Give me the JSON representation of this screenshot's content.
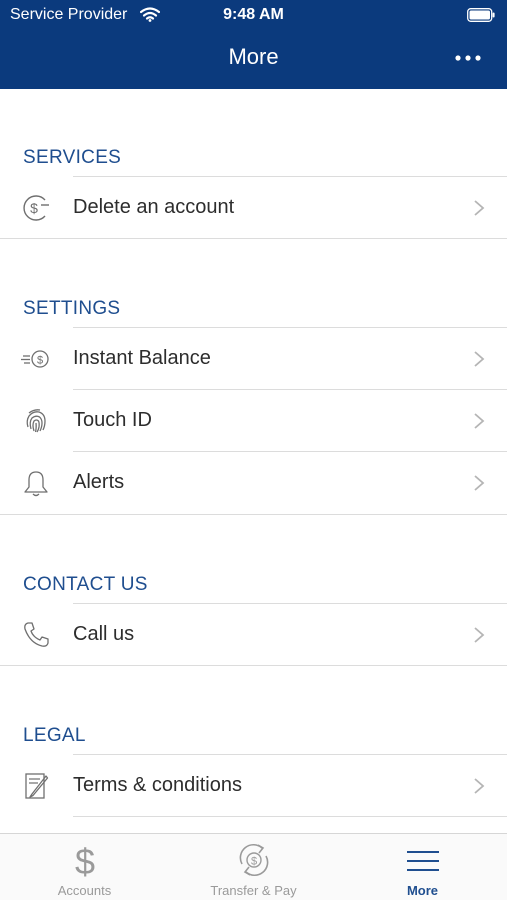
{
  "status": {
    "carrier": "Service Provider",
    "time": "9:48 AM"
  },
  "header": {
    "title": "More"
  },
  "sections": {
    "services": {
      "title": "SERVICES",
      "items": [
        {
          "label": "Delete an account"
        }
      ]
    },
    "settings": {
      "title": "SETTINGS",
      "items": [
        {
          "label": "Instant Balance"
        },
        {
          "label": "Touch ID"
        },
        {
          "label": "Alerts"
        }
      ]
    },
    "contact": {
      "title": "CONTACT US",
      "items": [
        {
          "label": "Call us"
        }
      ]
    },
    "legal": {
      "title": "LEGAL",
      "items": [
        {
          "label": "Terms & conditions"
        }
      ]
    }
  },
  "tabbar": {
    "tabs": [
      {
        "label": "Accounts",
        "icon": "dollar-icon"
      },
      {
        "label": "Transfer & Pay",
        "icon": "transfer-pay-icon"
      },
      {
        "label": "More",
        "icon": "menu-lines-icon",
        "active": true
      }
    ]
  },
  "colors": {
    "header_bg": "#0b3a7d",
    "accent": "#1f4e8f",
    "separator": "#dcdcdc"
  }
}
